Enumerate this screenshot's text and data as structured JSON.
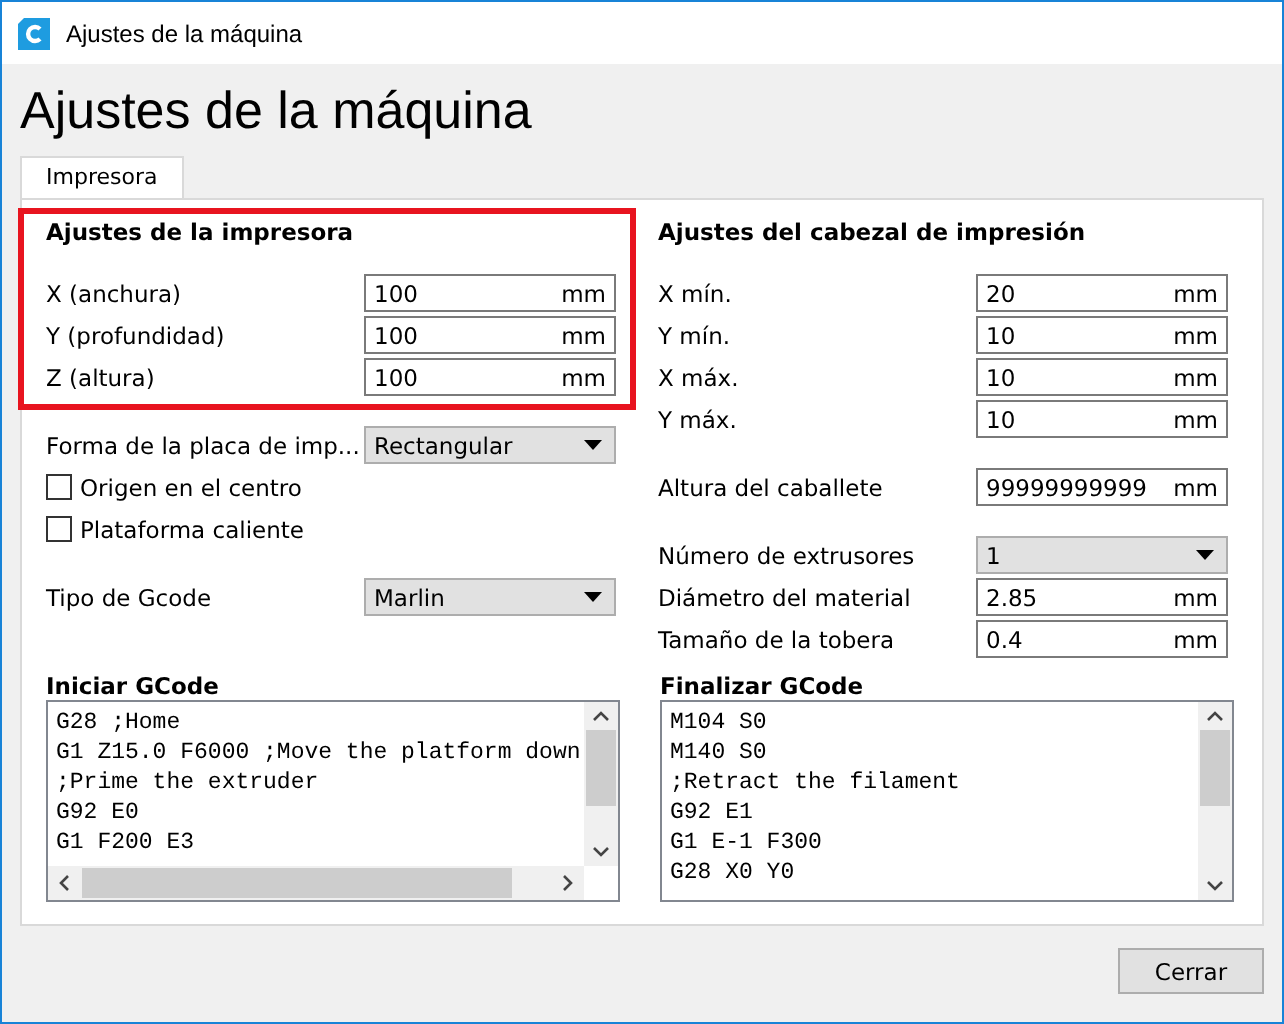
{
  "window": {
    "title": "Ajustes de la máquina"
  },
  "heading": "Ajustes de la máquina",
  "tabs": [
    {
      "label": "Impresora",
      "selected": true
    }
  ],
  "columns": [
    {
      "title": "Ajustes de la impresora",
      "groups": [
        [
          {
            "kind": "field",
            "label": "X (anchura)",
            "value": "100",
            "unit": "mm"
          },
          {
            "kind": "field",
            "label": "Y (profundidad)",
            "value": "100",
            "unit": "mm"
          },
          {
            "kind": "field",
            "label": "Z (altura)",
            "value": "100",
            "unit": "mm"
          }
        ],
        [
          {
            "kind": "dropdown",
            "label": "Forma de la placa de imp...",
            "value": "Rectangular"
          },
          {
            "kind": "checkbox",
            "label": "Origen en el centro",
            "checked": false
          },
          {
            "kind": "checkbox",
            "label": "Plataforma caliente",
            "checked": false
          }
        ],
        [
          {
            "kind": "dropdown",
            "label": "Tipo de Gcode",
            "value": "Marlin"
          }
        ]
      ]
    },
    {
      "title": "Ajustes del cabezal de impresión",
      "groups": [
        [
          {
            "kind": "field",
            "label": "X mín.",
            "value": "20",
            "unit": "mm"
          },
          {
            "kind": "field",
            "label": "Y mín.",
            "value": "10",
            "unit": "mm"
          },
          {
            "kind": "field",
            "label": "X máx.",
            "value": "10",
            "unit": "mm"
          },
          {
            "kind": "field",
            "label": "Y máx.",
            "value": "10",
            "unit": "mm"
          }
        ],
        [
          {
            "kind": "field",
            "label": "Altura del caballete",
            "value": "99999999999",
            "unit": "mm"
          }
        ],
        [
          {
            "kind": "dropdown",
            "label": "Número de extrusores",
            "value": "1"
          },
          {
            "kind": "field",
            "label": "Diámetro del material",
            "value": "2.85",
            "unit": "mm"
          },
          {
            "kind": "field",
            "label": "Tamaño de la tobera",
            "value": "0.4",
            "unit": "mm"
          }
        ]
      ]
    }
  ],
  "gcode": [
    {
      "title": "Iniciar GCode",
      "horizontal_scroll": true,
      "lines": [
        "G28 ;Home",
        "G1 Z15.0 F6000 ;Move the platform down",
        ";Prime the extruder",
        "G92 E0",
        "G1 F200 E3"
      ]
    },
    {
      "title": "Finalizar GCode",
      "horizontal_scroll": false,
      "lines": [
        "M104 S0",
        "M140 S0",
        ";Retract the filament",
        "G92 E1",
        "G1 E-1 F300",
        "G28 X0 Y0"
      ]
    }
  ],
  "buttons": [
    "Cerrar"
  ]
}
